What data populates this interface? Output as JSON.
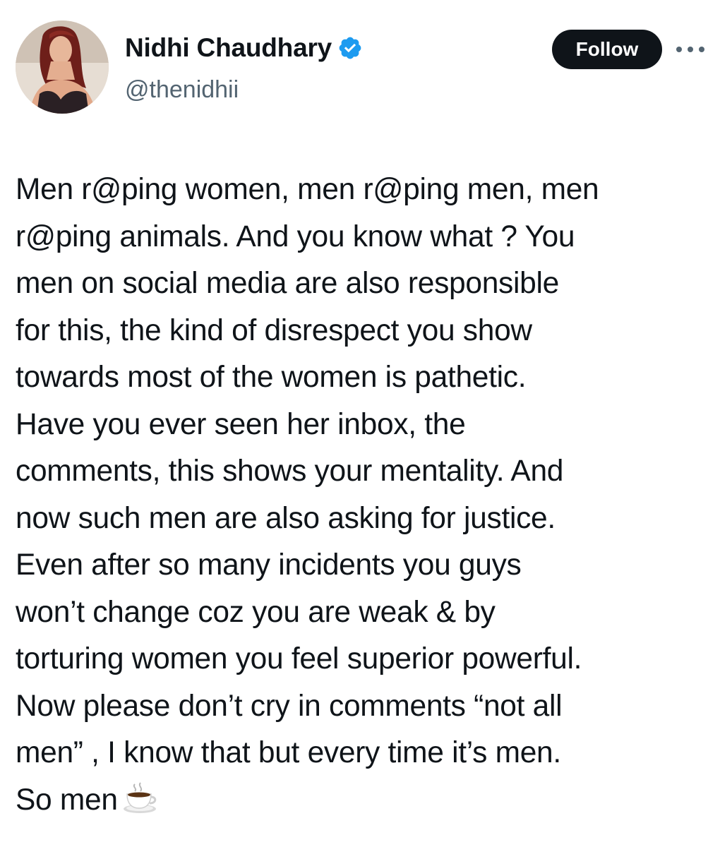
{
  "author": {
    "display_name": "Nidhi Chaudhary",
    "handle": "@thenidhii",
    "verified": true,
    "verified_color": "#1d9bf0"
  },
  "actions": {
    "follow_label": "Follow",
    "more_icon": "more-horizontal-icon"
  },
  "tweet": {
    "lines": [
      "Men r@ping women, men r@ping men, men",
      "r@ping animals. And you know what ? You",
      "men on social media are also responsible",
      "for this, the kind of disrespect you show",
      "towards most of the women is pathetic.",
      "Have you ever seen her inbox, the",
      "comments, this shows your mentality. And",
      "now such men are also asking for justice.",
      "Even after so many incidents you guys",
      "won’t change coz you are weak & by",
      "torturing women you feel superior powerful.",
      "Now please don’t cry in comments “not all",
      "men” , I know that but every time it’s men.",
      "So men"
    ],
    "trailing_emoji": "hot-beverage-emoji"
  },
  "colors": {
    "text": "#0f1419",
    "secondary_text": "#536471",
    "follow_bg": "#0f1419",
    "follow_text": "#ffffff",
    "background": "#ffffff"
  }
}
